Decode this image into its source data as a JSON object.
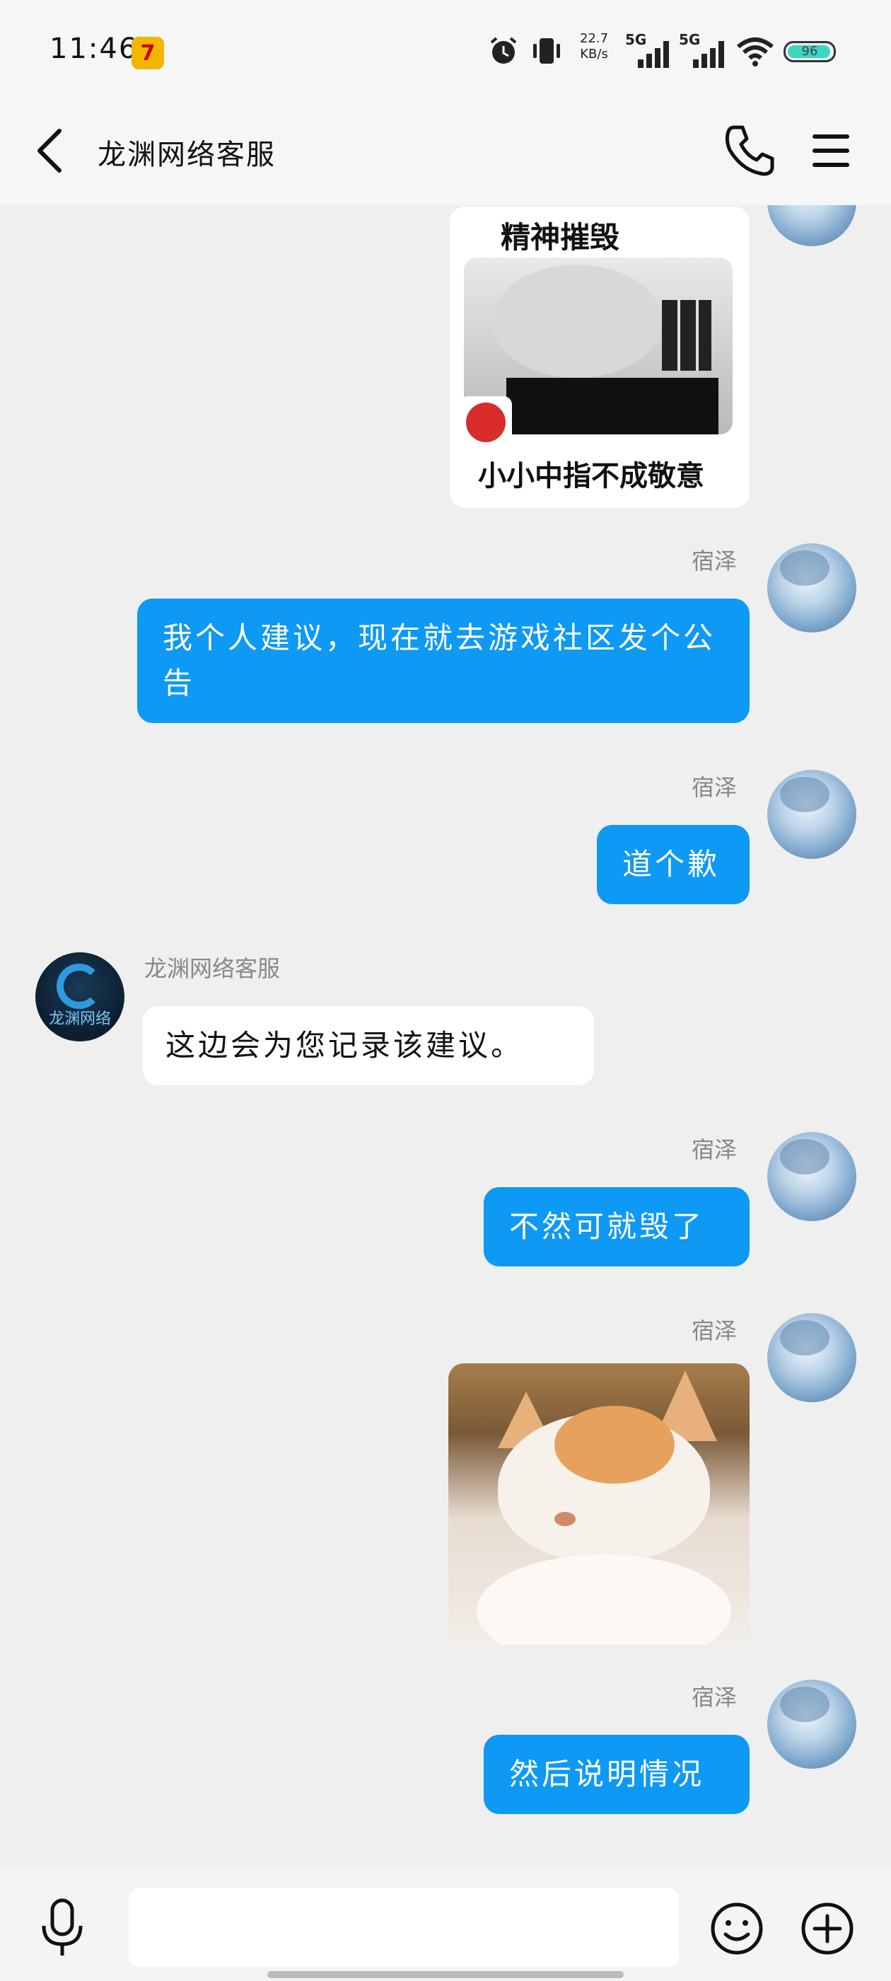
{
  "status_bar": {
    "time": "11:46",
    "network_speed_value": "22.7",
    "network_speed_unit": "KB/s",
    "signal1": "5G",
    "signal2": "5G",
    "battery": "96",
    "battery_level": 0.96
  },
  "header": {
    "title": "龙渊网络客服"
  },
  "messages": [
    {
      "type": "sticker",
      "side": "right",
      "top_text": "精神摧毁",
      "bottom_text": "小小中指不成敬意"
    },
    {
      "type": "text",
      "side": "right",
      "sender": "宿泽",
      "text": "我个人建议，现在就去游戏社区发个公告"
    },
    {
      "type": "text",
      "side": "right",
      "sender": "宿泽",
      "text": "道个歉"
    },
    {
      "type": "text",
      "side": "left",
      "sender": "龙渊网络客服",
      "avatar_text": "龙渊网络",
      "text": "这边会为您记录该建议。"
    },
    {
      "type": "text",
      "side": "right",
      "sender": "宿泽",
      "text": "不然可就毁了"
    },
    {
      "type": "sticker",
      "side": "right",
      "sender": "宿泽"
    },
    {
      "type": "text",
      "side": "right",
      "sender": "宿泽",
      "text": "然后说明情况"
    }
  ],
  "input": {
    "value": "",
    "placeholder": ""
  },
  "colors": {
    "bubble_blue": "#0e99f4",
    "background": "#efefef"
  },
  "icons": [
    "back-arrow-icon",
    "phone-icon",
    "menu-icon",
    "microphone-icon",
    "emoji-icon",
    "plus-icon",
    "alarm-icon",
    "vibrate-icon",
    "signal-icon",
    "wifi-icon",
    "battery-icon"
  ]
}
